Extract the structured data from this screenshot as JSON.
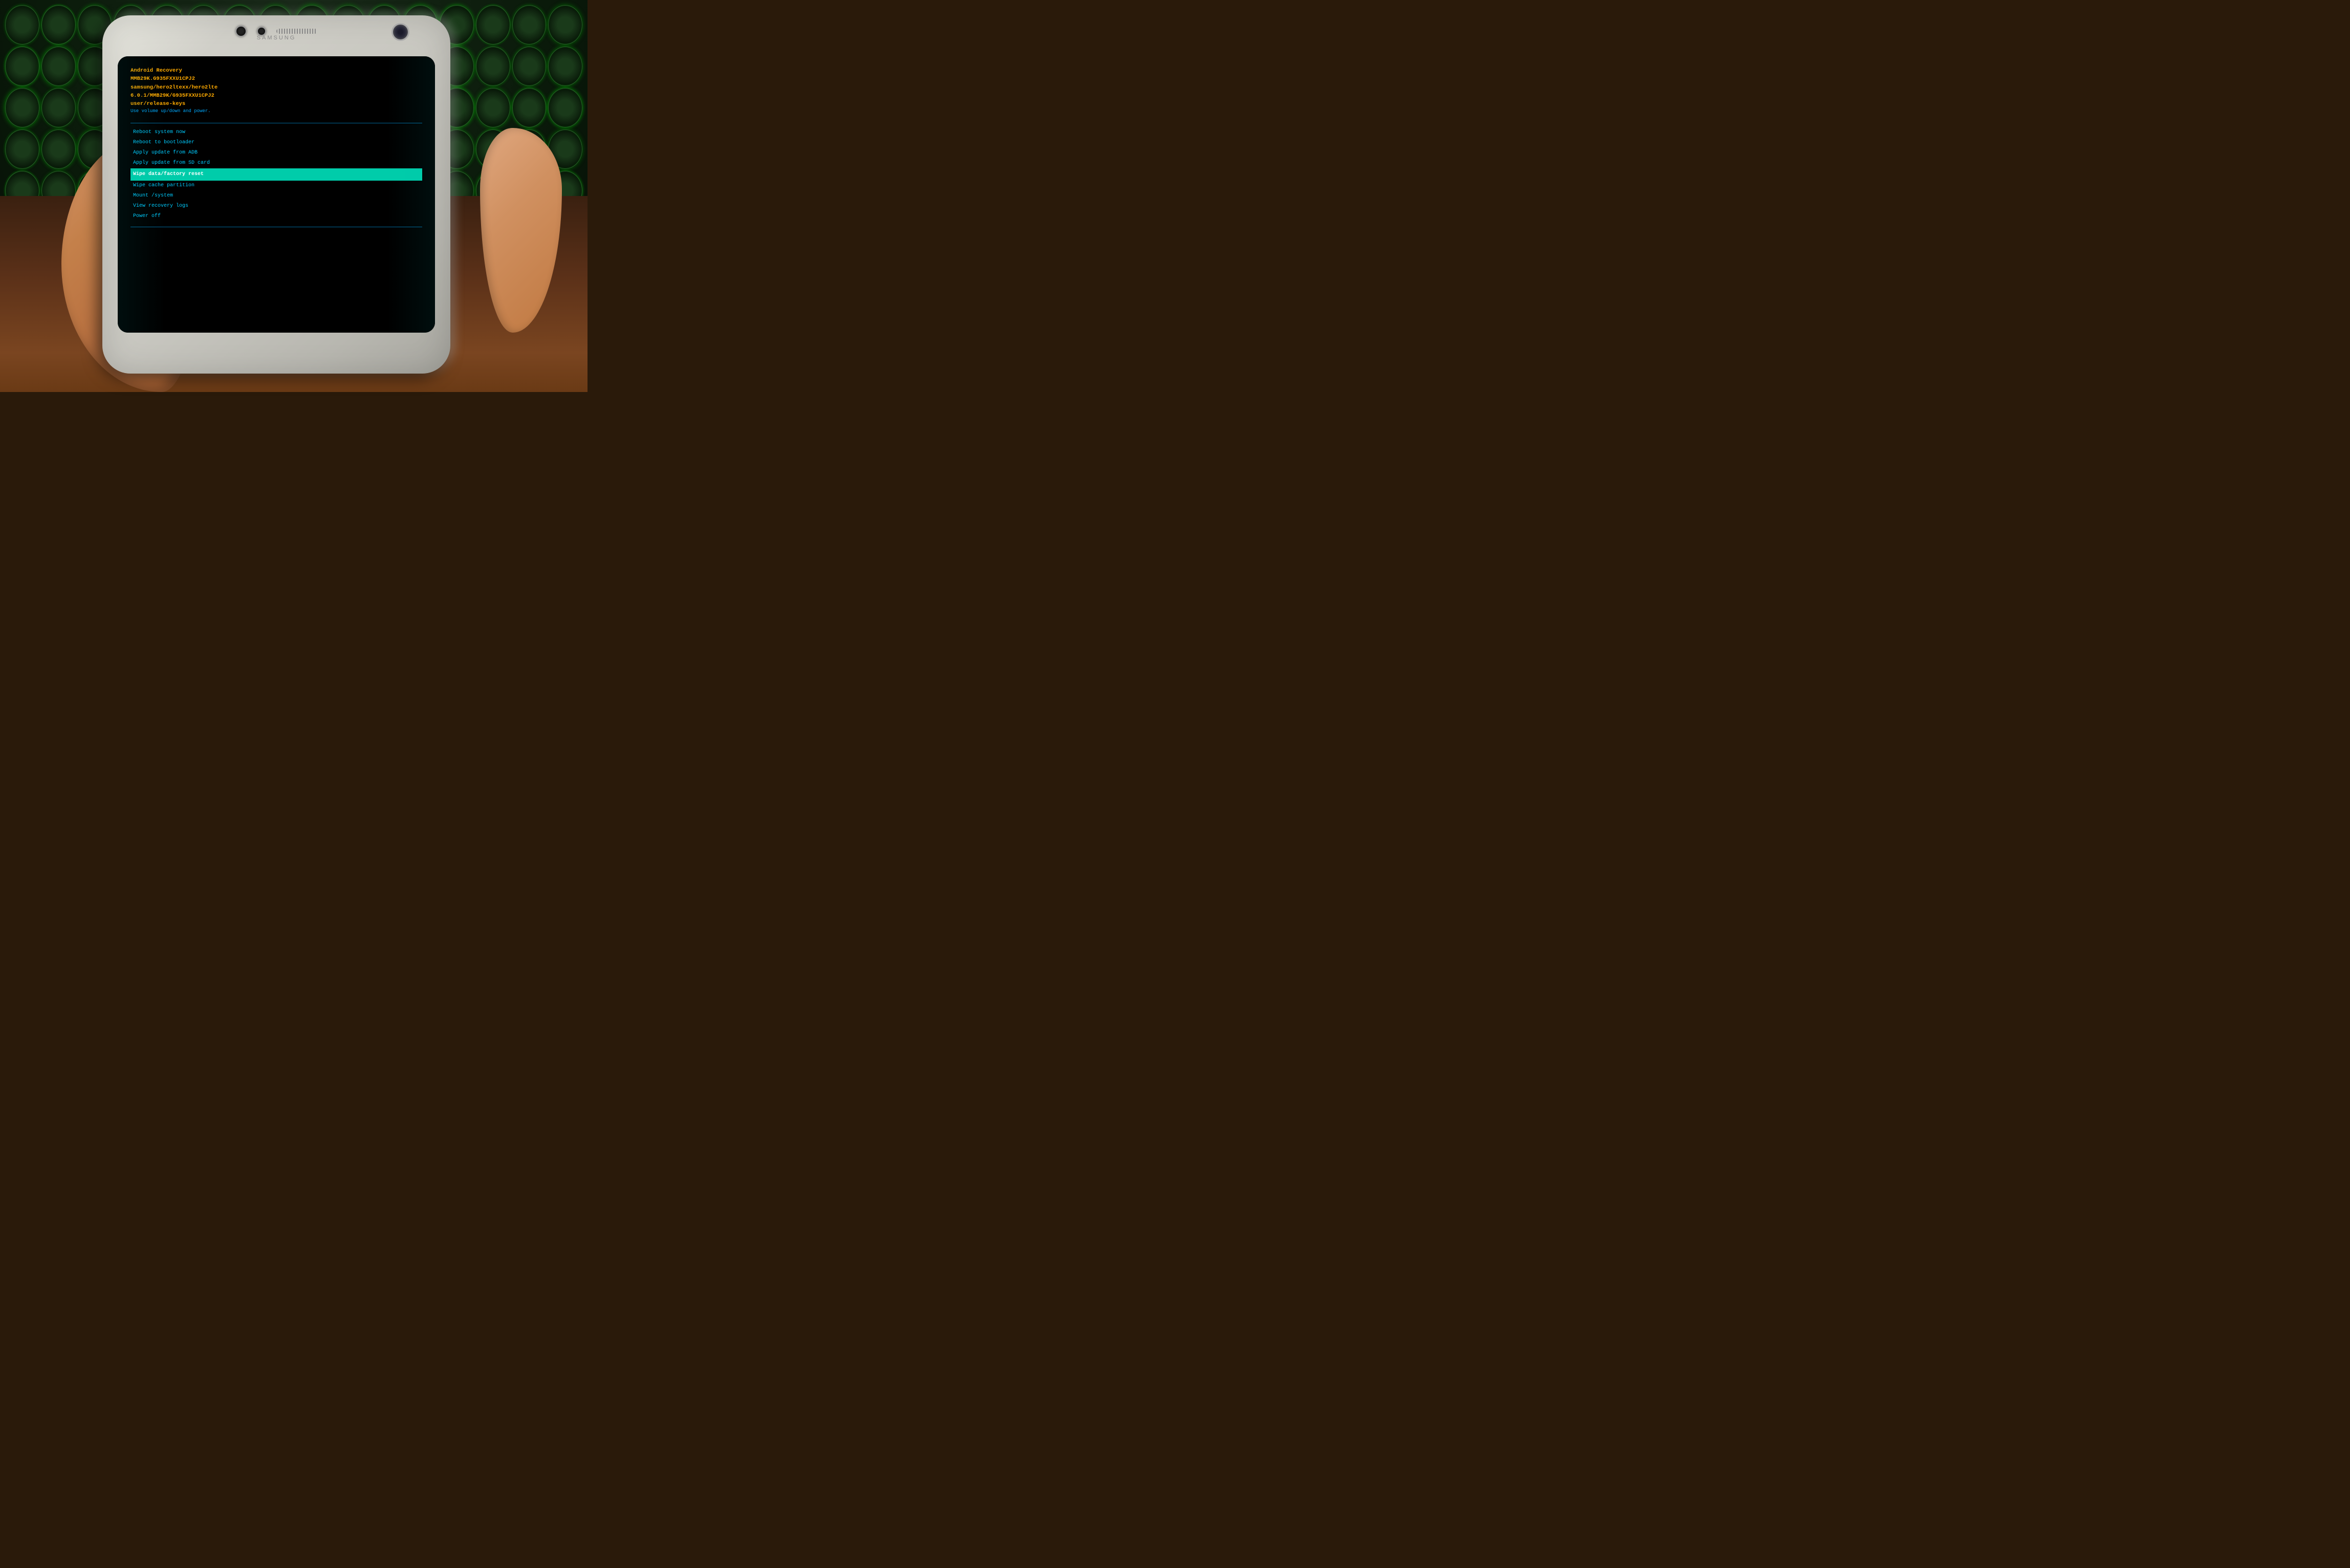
{
  "background": {
    "type": "keyboard_desk_scene",
    "keyboard_color": "#1a3a1a",
    "key_glow": "#00cc00",
    "desk_color": "#5a3018"
  },
  "phone": {
    "brand": "SAMSUNG",
    "body_color": "#d0cfc8",
    "screen_bg": "#000000"
  },
  "recovery": {
    "title": "Android Recovery",
    "build_info": [
      "MMB29K.G935FXXU1CPJ2",
      "samsung/hero2ltexx/hero2lte",
      "samsung/hero2ltexx/hero2lte",
      "6.0.1/MMB29K/G935FXXU1CPJ2",
      "user/release-keys",
      "Use volume up/down and power."
    ],
    "menu_items": [
      {
        "label": "Reboot system now",
        "selected": false
      },
      {
        "label": "Reboot to bootloader",
        "selected": false
      },
      {
        "label": "Apply update from ADB",
        "selected": false
      },
      {
        "label": "Apply update from SD card",
        "selected": false
      },
      {
        "label": "Wipe data/factory reset",
        "selected": true
      },
      {
        "label": "Wipe cache partition",
        "selected": false
      },
      {
        "label": "Mount /system",
        "selected": false
      },
      {
        "label": "View recovery logs",
        "selected": false
      },
      {
        "label": "Power off",
        "selected": false
      }
    ]
  }
}
